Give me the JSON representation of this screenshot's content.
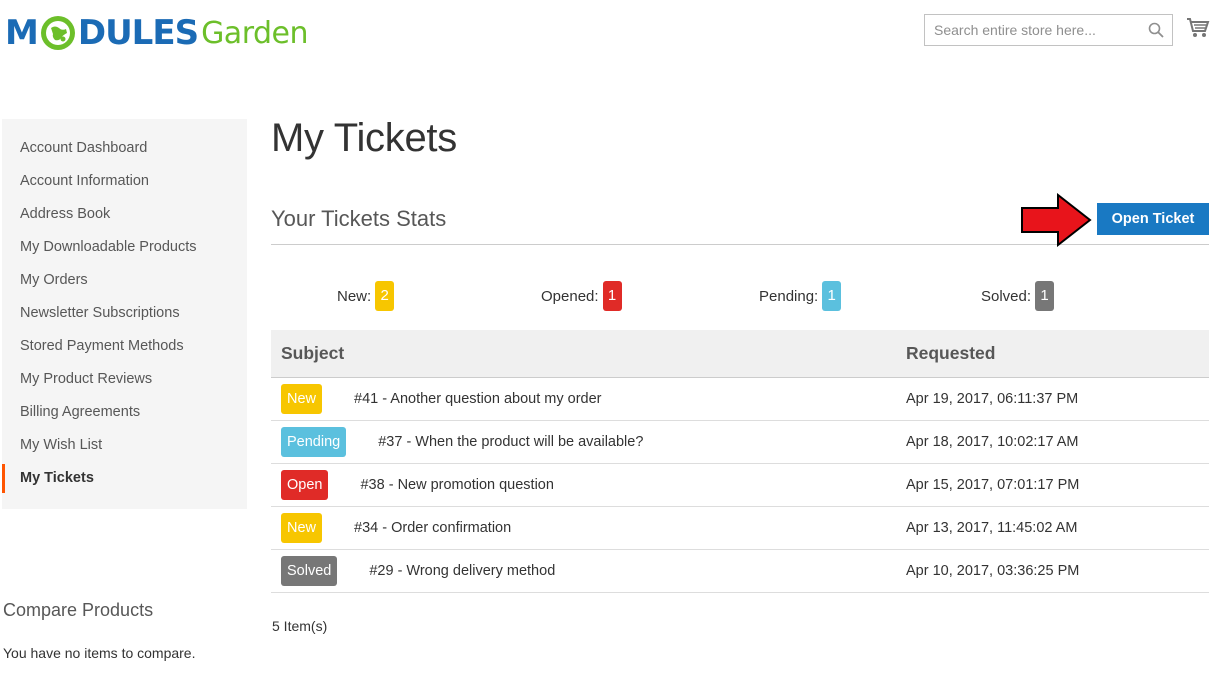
{
  "header": {
    "logo": {
      "part1": "M",
      "part2": "DULES",
      "part3": "Garden"
    },
    "search": {
      "placeholder": "Search entire store here...",
      "value": ""
    },
    "icons": {
      "search": "search-icon",
      "cart": "cart-icon"
    }
  },
  "sidebar": {
    "items": [
      {
        "label": "Account Dashboard",
        "active": false
      },
      {
        "label": "Account Information",
        "active": false
      },
      {
        "label": "Address Book",
        "active": false
      },
      {
        "label": "My Downloadable Products",
        "active": false
      },
      {
        "label": "My Orders",
        "active": false
      },
      {
        "label": "Newsletter Subscriptions",
        "active": false
      },
      {
        "label": "Stored Payment Methods",
        "active": false
      },
      {
        "label": "My Product Reviews",
        "active": false
      },
      {
        "label": "Billing Agreements",
        "active": false
      },
      {
        "label": "My Wish List",
        "active": false
      },
      {
        "label": "My Tickets",
        "active": true
      }
    ],
    "accent_color": "#ff5501"
  },
  "compare": {
    "title": "Compare Products",
    "empty_text": "You have no items to compare."
  },
  "main": {
    "page_title": "My Tickets",
    "stats_title": "Your Tickets Stats",
    "open_ticket_label": "Open Ticket",
    "stats": [
      {
        "label": "New:",
        "count": "2",
        "color": "#f7c600"
      },
      {
        "label": "Opened:",
        "count": "1",
        "color": "#e02b27"
      },
      {
        "label": "Pending:",
        "count": "1",
        "color": "#5bc0de"
      },
      {
        "label": "Solved:",
        "count": "1",
        "color": "#777777"
      }
    ],
    "table": {
      "headers": {
        "subject": "Subject",
        "requested": "Requested"
      },
      "rows": [
        {
          "status": "New",
          "status_color": "#f7c600",
          "subject": "#41 - Another question about my order",
          "requested": "Apr 19, 2017, 06:11:37 PM"
        },
        {
          "status": "Pending",
          "status_color": "#5bc0de",
          "subject": "#37 - When the product will be available?",
          "requested": "Apr 18, 2017, 10:02:17 AM"
        },
        {
          "status": "Open",
          "status_color": "#e02b27",
          "subject": "#38 - New promotion question",
          "requested": "Apr 15, 2017, 07:01:17 PM"
        },
        {
          "status": "New",
          "status_color": "#f7c600",
          "subject": "#34 - Order confirmation",
          "requested": "Apr 13, 2017, 11:45:02 AM"
        },
        {
          "status": "Solved",
          "status_color": "#777777",
          "subject": "#29 - Wrong delivery method",
          "requested": "Apr 10, 2017, 03:36:25 PM"
        }
      ]
    },
    "item_count": "5 Item(s)"
  },
  "colors": {
    "primary_button": "#1979c3",
    "arrow": "#e8141b",
    "logo_blue": "#1b6bb5",
    "logo_green": "#6cbf2a"
  }
}
